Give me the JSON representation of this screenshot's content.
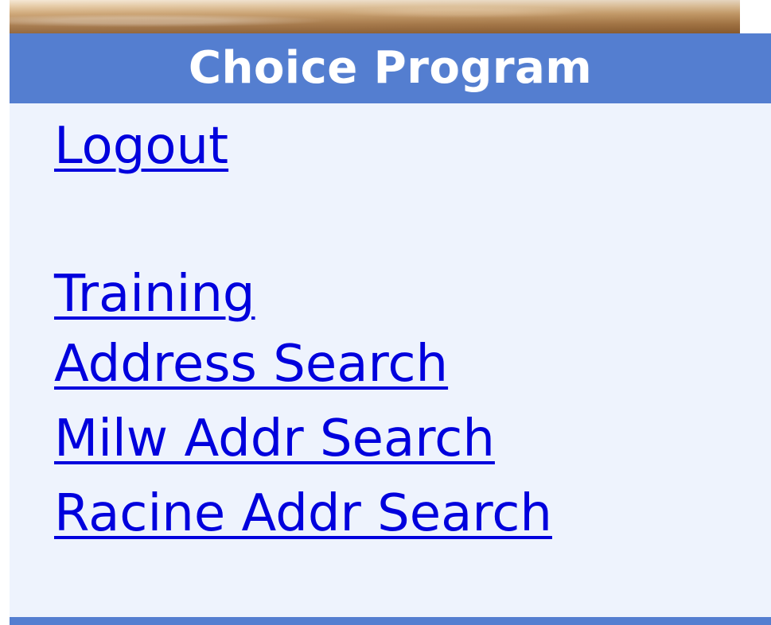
{
  "menu": {
    "title": "Choice Program",
    "items": [
      {
        "label": "Logout"
      },
      {
        "label": "Training"
      },
      {
        "label": "Address Search"
      },
      {
        "label": "Milw Addr Search"
      },
      {
        "label": "Racine Addr Search"
      }
    ]
  },
  "colors": {
    "header_background": "#547ed0",
    "panel_background": "#eef3fd",
    "link_color": "#0000dd"
  }
}
